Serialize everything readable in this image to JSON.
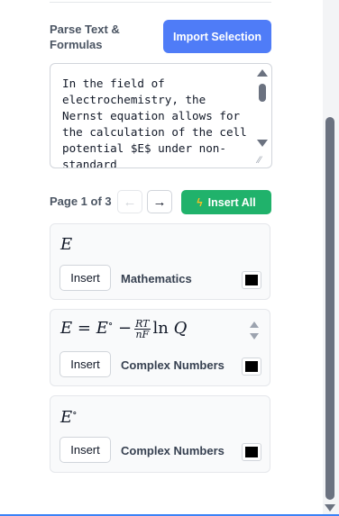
{
  "header": {
    "parse_label": "Parse Text & Formulas",
    "import_button": "Import Selection"
  },
  "source_text": {
    "value": "In the field of electrochemistry, the Nernst equation allows for the calculation of the cell potential $E$ under non-standard"
  },
  "pager": {
    "label": "Page 1 of 3",
    "prev": "←",
    "next": "→",
    "insert_all": "Insert All",
    "insert_all_icon": "bolt-icon"
  },
  "formulas": [
    {
      "latex_display": "E",
      "insert_label": "Insert",
      "category": "Mathematics",
      "color": "#000000"
    },
    {
      "latex_display": "E = E° − RT/nF ln Q",
      "insert_label": "Insert",
      "category": "Complex Numbers",
      "color": "#000000"
    },
    {
      "latex_display": "E°",
      "insert_label": "Insert",
      "category": "Complex Numbers",
      "color": "#000000"
    }
  ],
  "colors": {
    "primary": "#4f7cf7",
    "success": "#20b26b"
  }
}
